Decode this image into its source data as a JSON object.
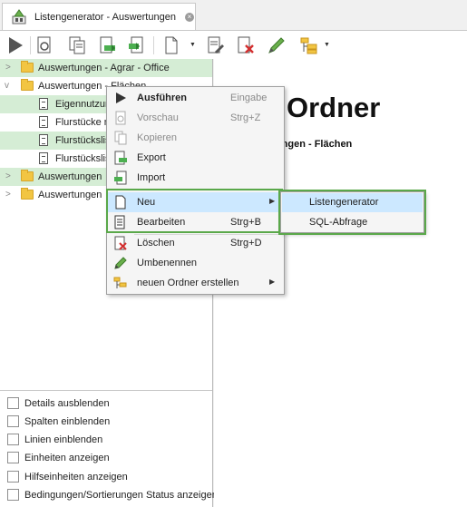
{
  "tab": {
    "title": "Listengenerator - Auswertungen",
    "icon": "listengenerator-icon",
    "close_icon": "close-icon"
  },
  "toolbar": {
    "icons": [
      "run-icon",
      "preview-icon",
      "copy-icon",
      "export-icon",
      "import-icon",
      "new-document-icon",
      "edit-icon",
      "delete-icon",
      "rename-icon",
      "new-folder-icon"
    ]
  },
  "tree": {
    "items": [
      {
        "label": "Auswertungen - Agrar - Office",
        "type": "folder",
        "state": "collapsed",
        "selected": true
      },
      {
        "label": "Auswertungen - Flächen",
        "type": "folder",
        "state": "expanded",
        "selected": false
      },
      {
        "label": "Eigennutzung",
        "type": "doc",
        "selected": true
      },
      {
        "label": "Flurstücke n",
        "type": "doc",
        "selected": false
      },
      {
        "label": "Flurstückslis",
        "type": "doc",
        "selected": true
      },
      {
        "label": "Flurstückslis",
        "type": "doc",
        "selected": false
      },
      {
        "label": "Auswertungen",
        "type": "folder",
        "state": "collapsed",
        "selected": true
      },
      {
        "label": "Auswertungen",
        "type": "folder",
        "state": "collapsed",
        "selected": false
      }
    ]
  },
  "options": [
    {
      "label": "Details ausblenden",
      "checked": false
    },
    {
      "label": "Spalten einblenden",
      "checked": false
    },
    {
      "label": "Linien einblenden",
      "checked": false
    },
    {
      "label": "Einheiten anzeigen",
      "checked": false
    },
    {
      "label": "Hilfseinheiten anzeigen",
      "checked": false
    },
    {
      "label": "Bedingungen/Sortierungen Status anzeigen",
      "checked": false
    }
  ],
  "detail": {
    "title": "Ordner",
    "subtitle": "rtungen - Flächen"
  },
  "context_menu": {
    "items": [
      {
        "label": "Ausführen",
        "shortcut": "Eingabe",
        "icon": "run-icon",
        "disabled": false,
        "bold": true
      },
      {
        "label": "Vorschau",
        "shortcut": "Strg+Z",
        "icon": "preview-icon",
        "disabled": true
      },
      {
        "label": "Kopieren",
        "shortcut": "",
        "icon": "copy-icon",
        "disabled": true
      },
      {
        "label": "Export",
        "shortcut": "",
        "icon": "export-icon",
        "disabled": false
      },
      {
        "label": "Import",
        "shortcut": "",
        "icon": "import-icon",
        "disabled": false
      },
      {
        "label": "Neu",
        "shortcut": "",
        "icon": "new-document-icon",
        "disabled": false,
        "submenu": true
      },
      {
        "label": "Bearbeiten",
        "shortcut": "Strg+B",
        "icon": "edit-icon",
        "disabled": false
      },
      {
        "label": "Löschen",
        "shortcut": "Strg+D",
        "icon": "delete-icon",
        "disabled": false
      },
      {
        "label": "Umbenennen",
        "shortcut": "",
        "icon": "rename-icon",
        "disabled": false
      },
      {
        "label": "neuen Ordner erstellen",
        "shortcut": "",
        "icon": "new-folder-icon",
        "disabled": false,
        "submenu": true
      }
    ]
  },
  "submenu": {
    "items": [
      {
        "label": "Listengenerator"
      },
      {
        "label": "SQL-Abfrage"
      }
    ]
  },
  "colors": {
    "accent_green": "#5aa84a",
    "selection_green": "#d5edd5",
    "hover_blue": "#cce8ff"
  }
}
